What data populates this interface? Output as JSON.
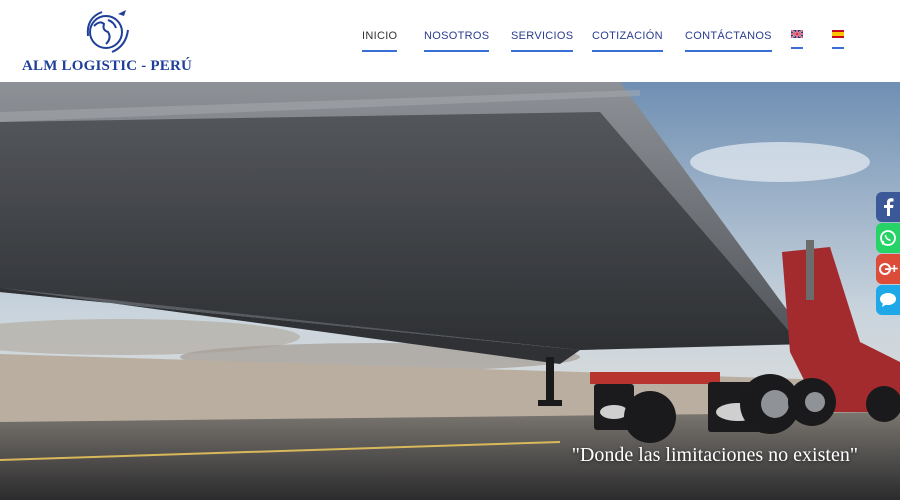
{
  "brand": {
    "name": "ALM LOGISTIC - PERÚ",
    "logo_icon": "globe-plane-logo"
  },
  "nav": {
    "items": [
      {
        "label": "INICIO",
        "active": true
      },
      {
        "label": "NOSOTROS",
        "active": false
      },
      {
        "label": "SERVICIOS",
        "active": false
      },
      {
        "label": "COTIZACIÓN",
        "active": false
      },
      {
        "label": "CONTÁCTANOS",
        "active": false
      }
    ],
    "languages": [
      {
        "code": "en",
        "icon": "uk-flag-icon"
      },
      {
        "code": "es",
        "icon": "spain-flag-icon"
      }
    ]
  },
  "hero": {
    "slogan": "\"Donde las limitaciones no existen\"",
    "image": "truck-trailer-on-highway"
  },
  "social": [
    {
      "name": "facebook",
      "icon": "facebook-icon",
      "color": "#3b5998"
    },
    {
      "name": "whatsapp",
      "icon": "whatsapp-icon",
      "color": "#25d366"
    },
    {
      "name": "google-plus",
      "icon": "google-plus-icon",
      "color": "#dd4b39"
    },
    {
      "name": "messenger",
      "icon": "chat-icon",
      "color": "#1fa8e8"
    }
  ],
  "colors": {
    "brand_blue": "#1f3f9a",
    "nav_text": "#2a3c8f",
    "nav_underline": "#3a6fd8"
  }
}
